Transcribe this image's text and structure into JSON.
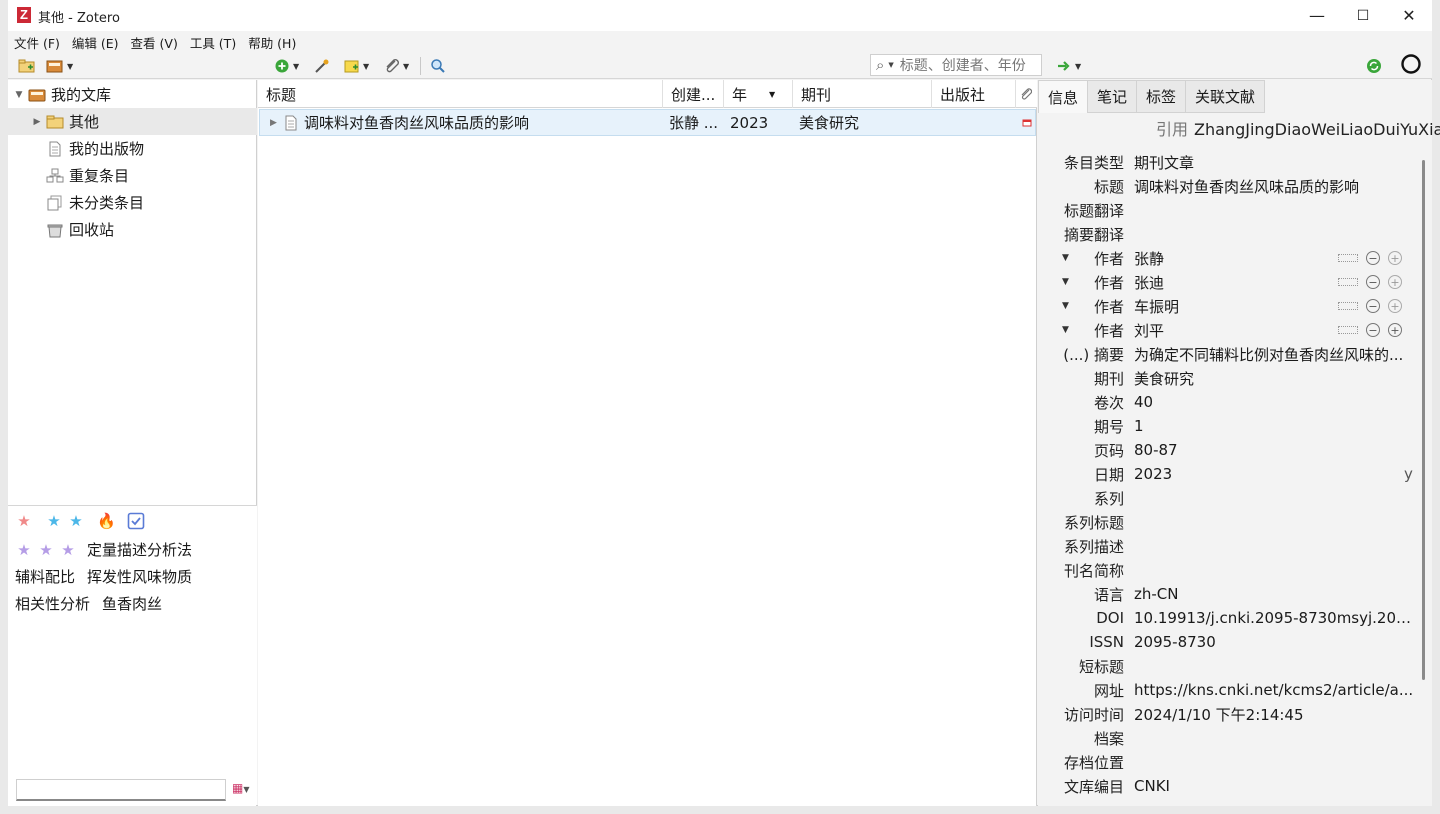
{
  "window": {
    "title": "其他 - Zotero",
    "logo_letter": "Z",
    "minimize": "—",
    "maximize": "☐",
    "close": "✕"
  },
  "menu": [
    "文件 (F)",
    "编辑 (E)",
    "查看 (V)",
    "工具 (T)",
    "帮助 (H)"
  ],
  "toolbar": {
    "search_placeholder": "标题、创建者、年份",
    "search_icon": "⌕"
  },
  "library": {
    "root": "我的文库",
    "items": [
      "其他",
      "我的出版物",
      "重复条目",
      "未分类条目",
      "回收站"
    ]
  },
  "tags": {
    "line1": [
      "定量描述分析法"
    ],
    "line2": [
      "辅料配比",
      "挥发性风味物质"
    ],
    "line3": [
      "相关性分析",
      "鱼香肉丝"
    ]
  },
  "columns": {
    "title": "标题",
    "creator": "创建...",
    "year": "年",
    "journal": "期刊",
    "publisher": "出版社"
  },
  "item": {
    "title": "调味料对鱼香肉丝风味品质的影响",
    "creator": "张静 ...",
    "year": "2023",
    "journal": "美食研究"
  },
  "tabs": [
    "信息",
    "笔记",
    "标签",
    "关联文献"
  ],
  "cite": {
    "label": "引用",
    "key": "ZhangJingDiaoWeiLiaoDuiYuXiang"
  },
  "fields": [
    {
      "label": "条目类型",
      "value": "期刊文章"
    },
    {
      "label": "标题",
      "value": "调味料对鱼香肉丝风味品质的影响"
    },
    {
      "label": "标题翻译",
      "value": ""
    },
    {
      "label": "摘要翻译",
      "value": ""
    },
    {
      "label": "作者",
      "value": "张静"
    },
    {
      "label": "作者",
      "value": "张迪"
    },
    {
      "label": "作者",
      "value": "车振明"
    },
    {
      "label": "作者",
      "value": "刘平"
    },
    {
      "label": "(...) 摘要",
      "value": "为确定不同辅料比例对鱼香肉丝风味的..."
    },
    {
      "label": "期刊",
      "value": "美食研究"
    },
    {
      "label": "卷次",
      "value": "40"
    },
    {
      "label": "期号",
      "value": "1"
    },
    {
      "label": "页码",
      "value": "80-87"
    },
    {
      "label": "日期",
      "value": "2023"
    },
    {
      "label": "系列",
      "value": ""
    },
    {
      "label": "系列标题",
      "value": ""
    },
    {
      "label": "系列描述",
      "value": ""
    },
    {
      "label": "刊名简称",
      "value": ""
    },
    {
      "label": "语言",
      "value": "zh-CN"
    },
    {
      "label": "DOI",
      "value": "10.19913/j.cnki.2095-8730msyj.202..."
    },
    {
      "label": "ISSN",
      "value": "2095-8730"
    },
    {
      "label": "短标题",
      "value": ""
    },
    {
      "label": "网址",
      "value": "https://kns.cnki.net/kcms2/article/a..."
    },
    {
      "label": "访问时间",
      "value": "2024/1/10 下午2:14:45"
    },
    {
      "label": "档案",
      "value": ""
    },
    {
      "label": "存档位置",
      "value": ""
    },
    {
      "label": "文库编目",
      "value": "CNKI"
    }
  ],
  "date_flag": "y",
  "colors": {
    "accent_select": "#e7f2fb",
    "logo_red": "#cc2936"
  }
}
